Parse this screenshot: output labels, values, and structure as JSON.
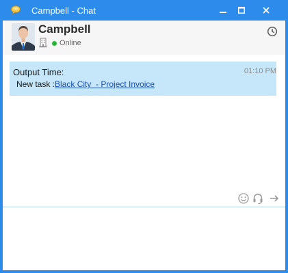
{
  "window": {
    "title": "Campbell - Chat",
    "accent_color": "#2d8ceb",
    "app_icon": "chat-bubble-icon",
    "controls": [
      "minimize-icon",
      "maximize-icon",
      "close-icon"
    ]
  },
  "contact": {
    "name": "Campbell",
    "status": "Online",
    "status_color": "#28b43a",
    "location_icon": "building-icon",
    "history_icon": "clock-icon"
  },
  "messages": [
    {
      "sender": "Output Time:",
      "time": "01:10 PM",
      "text_prefix": "New task :",
      "link_text": "Black City  - Project Invoice",
      "bubble_color": "#c5e7f9"
    }
  ],
  "toolbar": {
    "icons": [
      "smiley-icon",
      "headset-icon",
      "send-arrow-icon"
    ]
  },
  "compose": {
    "value": ""
  }
}
